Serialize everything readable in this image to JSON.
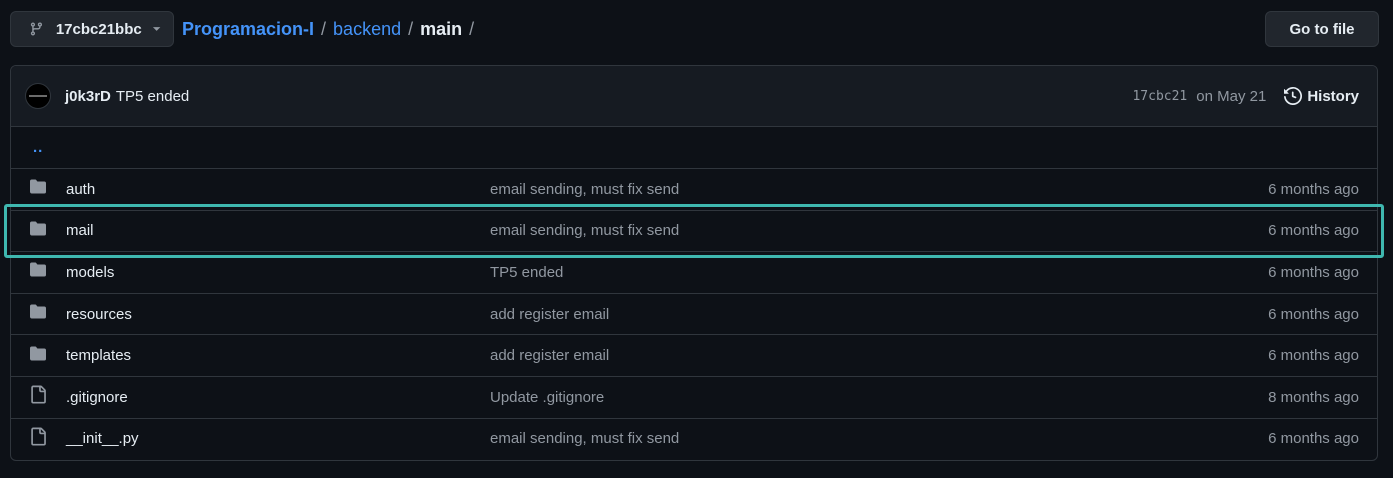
{
  "header": {
    "branch": "17cbc21bbc",
    "breadcrumb": {
      "repo": "Programacion-I",
      "sep1": "/",
      "dir1": "backend",
      "sep2": "/",
      "current": "main",
      "sep3": "/"
    },
    "goto_file": "Go to file"
  },
  "commit": {
    "author": "j0k3rD",
    "message": "TP5 ended",
    "sha": "17cbc21",
    "date": "on May 21",
    "history_label": "History"
  },
  "parent_dir": "..",
  "files": [
    {
      "type": "folder-icon",
      "name": "auth",
      "message": "email sending, must fix send",
      "age": "6 months ago"
    },
    {
      "type": "folder-icon",
      "name": "mail",
      "message": "email sending, must fix send",
      "age": "6 months ago"
    },
    {
      "type": "folder-icon",
      "name": "models",
      "message": "TP5 ended",
      "age": "6 months ago"
    },
    {
      "type": "folder-icon",
      "name": "resources",
      "message": "add register email",
      "age": "6 months ago"
    },
    {
      "type": "folder-icon",
      "name": "templates",
      "message": "add register email",
      "age": "6 months ago"
    },
    {
      "type": "file-icon",
      "name": ".gitignore",
      "message": "Update .gitignore",
      "age": "8 months ago"
    },
    {
      "type": "file-icon",
      "name": "__init__.py",
      "message": "email sending, must fix send",
      "age": "6 months ago"
    }
  ],
  "colors": {
    "background": "#0d1117",
    "link": "#4493f8",
    "muted": "#9198a1",
    "highlight": "#3fb8b0"
  }
}
